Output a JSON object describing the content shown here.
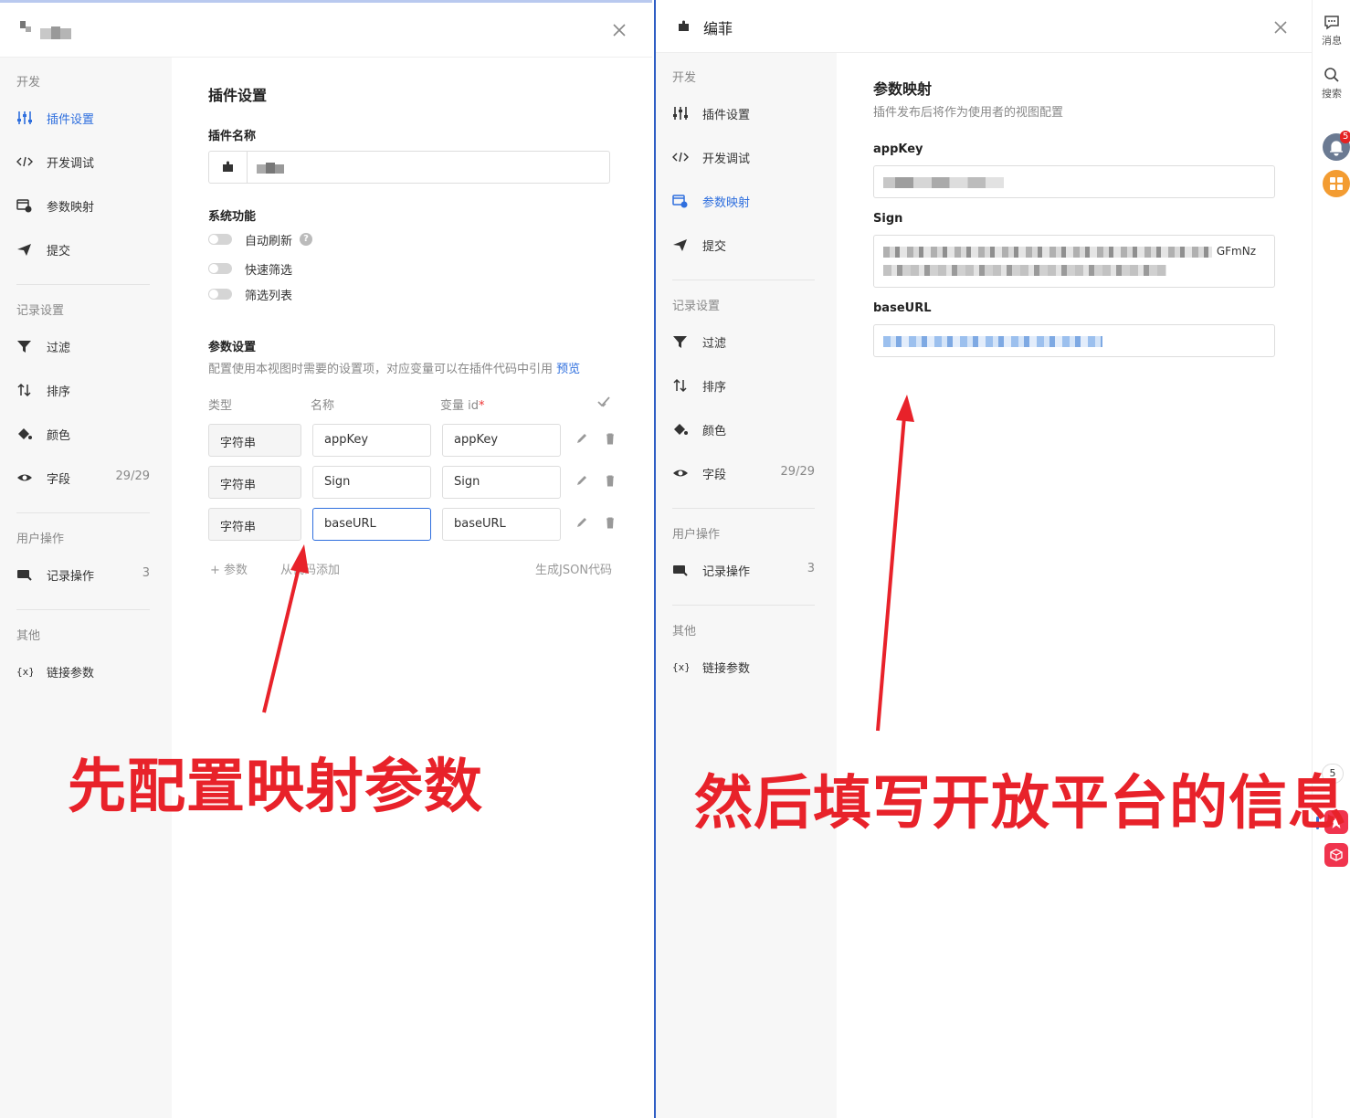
{
  "left_panel": {
    "sidebar": {
      "groups": [
        {
          "title": "开发",
          "items": [
            {
              "label": "插件设置",
              "icon": "sliders-icon",
              "active": true
            },
            {
              "label": "开发调试",
              "icon": "code-icon"
            },
            {
              "label": "参数映射",
              "icon": "mapping-icon"
            },
            {
              "label": "提交",
              "icon": "send-icon"
            }
          ]
        },
        {
          "title": "记录设置",
          "items": [
            {
              "label": "过滤",
              "icon": "filter-icon"
            },
            {
              "label": "排序",
              "icon": "sort-icon"
            },
            {
              "label": "颜色",
              "icon": "paint-bucket-icon"
            },
            {
              "label": "字段",
              "icon": "eye-icon",
              "count": "29/29"
            }
          ]
        },
        {
          "title": "用户操作",
          "items": [
            {
              "label": "记录操作",
              "icon": "record-action-icon",
              "count": "3"
            }
          ]
        },
        {
          "title": "其他",
          "items": [
            {
              "label": "链接参数",
              "icon": "braces-x-icon"
            }
          ]
        }
      ]
    },
    "main": {
      "title": "插件设置",
      "plugin_name_label": "插件名称",
      "system_label": "系统功能",
      "toggles": [
        {
          "label": "自动刷新",
          "help": "?"
        },
        {
          "label": "快速筛选"
        },
        {
          "label": "筛选列表"
        }
      ],
      "params_title": "参数设置",
      "params_desc": "配置使用本视图时需要的设置项，对应变量可以在插件代码中引用",
      "preview_link": "预览",
      "columns": {
        "type": "类型",
        "name": "名称",
        "var": "变量 id",
        "required_mark": "*"
      },
      "rows": [
        {
          "type": "字符串",
          "name": "appKey",
          "var": "appKey"
        },
        {
          "type": "字符串",
          "name": "Sign",
          "var": "Sign"
        },
        {
          "type": "字符串",
          "name": "baseURL",
          "var": "baseURL"
        }
      ],
      "add_param": "参数",
      "add_from_code": "从代码添加",
      "gen_json": "生成JSON代码"
    }
  },
  "right_panel": {
    "title": "编菲",
    "sidebar": {
      "groups": [
        {
          "title": "开发",
          "items": [
            {
              "label": "插件设置",
              "icon": "sliders-icon"
            },
            {
              "label": "开发调试",
              "icon": "code-icon"
            },
            {
              "label": "参数映射",
              "icon": "mapping-icon",
              "active": true
            },
            {
              "label": "提交",
              "icon": "send-icon"
            }
          ]
        },
        {
          "title": "记录设置",
          "items": [
            {
              "label": "过滤",
              "icon": "filter-icon"
            },
            {
              "label": "排序",
              "icon": "sort-icon"
            },
            {
              "label": "颜色",
              "icon": "paint-bucket-icon"
            },
            {
              "label": "字段",
              "icon": "eye-icon",
              "count": "29/29"
            }
          ]
        },
        {
          "title": "用户操作",
          "items": [
            {
              "label": "记录操作",
              "icon": "record-action-icon",
              "count": "3"
            }
          ]
        },
        {
          "title": "其他",
          "items": [
            {
              "label": "链接参数",
              "icon": "braces-x-icon"
            }
          ]
        }
      ]
    },
    "main": {
      "title": "参数映射",
      "desc": "插件发布后将作为使用者的视图配置",
      "fields": [
        {
          "label": "appKey"
        },
        {
          "label": "Sign",
          "visible_tail": "GFmNz"
        },
        {
          "label": "baseURL"
        }
      ]
    }
  },
  "utility_bar": {
    "messages_label": "消息",
    "search_label": "搜索",
    "notification_badge": "5",
    "count_pill": "5"
  },
  "annotations": {
    "left": "先配置映射参数",
    "right": "然后填写开放平台的信息"
  },
  "colors": {
    "accent": "#2f6fde",
    "annotation": "#e8222a",
    "focus_border": "#2f6fde"
  }
}
